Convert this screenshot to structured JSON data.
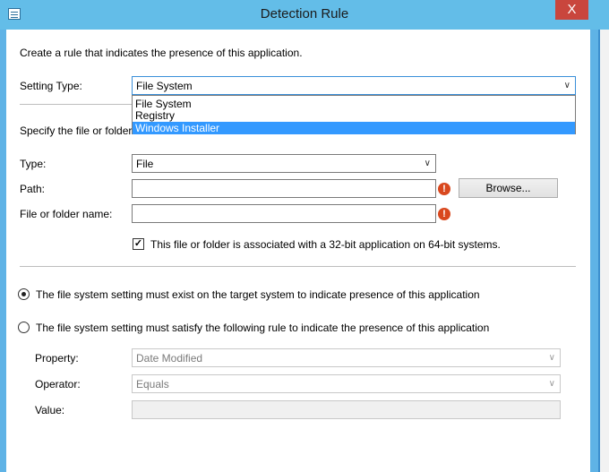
{
  "window": {
    "title": "Detection Rule",
    "close_glyph": "X"
  },
  "intro_text": "Create a rule that indicates the presence of this application.",
  "setting_type": {
    "label": "Setting Type:",
    "value": "File System",
    "options": [
      "File System",
      "Registry",
      "Windows Installer"
    ],
    "highlighted_option": "Windows Installer"
  },
  "specify_text": "Specify the file or folder t",
  "type_field": {
    "label": "Type:",
    "value": "File"
  },
  "path_field": {
    "label": "Path:",
    "value": "",
    "browse_label": "Browse..."
  },
  "name_field": {
    "label": "File or folder name:",
    "value": ""
  },
  "is_32bit": {
    "checked": true,
    "glyph": "✓",
    "label": "This file or folder is associated with a 32-bit application on 64-bit systems."
  },
  "rule_options": {
    "exist_label": "The file system setting must exist on the target system to indicate presence of this application",
    "satisfy_label": "The file system setting must satisfy the following rule to indicate the presence of this application",
    "selected": "exist"
  },
  "rule": {
    "property_label": "Property:",
    "property_value": "Date Modified",
    "operator_label": "Operator:",
    "operator_value": "Equals",
    "value_label": "Value:",
    "value": ""
  },
  "error_glyph": "!",
  "dropdown_arrow": "∨",
  "colors": {
    "title_bar": "#63bde8",
    "close_button": "#c9463d",
    "selection": "#3399ff",
    "error_icon": "#d9481e"
  }
}
